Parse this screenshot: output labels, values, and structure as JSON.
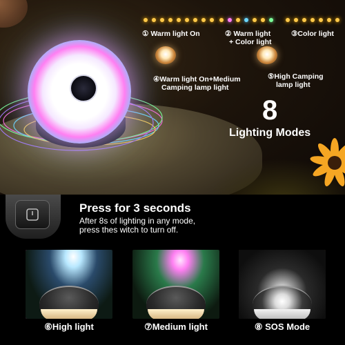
{
  "modes": {
    "m1": "① Warm light On",
    "m2_line1": "② Warm light",
    "m2_line2": "+ Color light",
    "m3": "③Color light",
    "m4_line1": "④Warm light On+Medium",
    "m4_line2": "Camping lamp light",
    "m5_line1": "⑤High Camping",
    "m5_line2": "lamp light"
  },
  "headline": {
    "number": "8",
    "title": "Lighting Modes"
  },
  "instructions": {
    "title": "Press for 3 seconds",
    "line1": "After 8s of  lighting in any mode,",
    "line2": "press thes witch to turn off."
  },
  "cards": [
    {
      "label": "⑥High light"
    },
    {
      "label": "⑦Medium light"
    },
    {
      "label": "⑧ SOS Mode"
    }
  ],
  "icons": {
    "power": "power-icon",
    "flower": "sunflower-icon",
    "lamp": "camping-lamp-icon"
  },
  "colors": {
    "warm": "#ffc94a",
    "pink": "#ff7ff2",
    "cyan": "#6bd7ff"
  }
}
